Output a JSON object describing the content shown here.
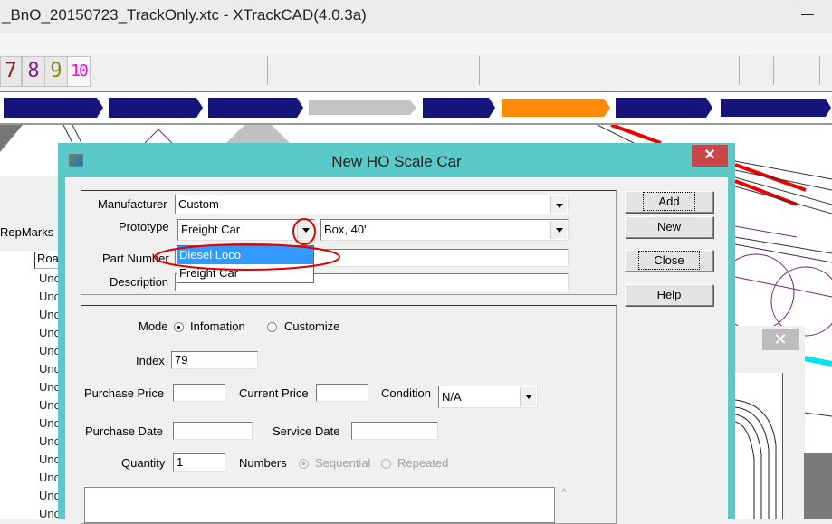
{
  "window": {
    "title": "_BnO_20150723_TrackOnly.xtc - XTrackCAD(4.0.3a)"
  },
  "toolbar": {
    "layer_buttons": [
      {
        "label": "7",
        "color": "#8b1a1a"
      },
      {
        "label": "8",
        "color": "#8b1a8b"
      },
      {
        "label": "9",
        "color": "#8b8b1a"
      },
      {
        "label": "10",
        "color": "#ff00ff"
      }
    ]
  },
  "map_strip": {
    "segments": [
      {
        "color": "#14147a"
      },
      {
        "color": "#14147a"
      },
      {
        "color": "#14147a"
      },
      {
        "color": "#c4c4c4"
      },
      {
        "color": "#14147a"
      },
      {
        "color": "#ff8a0a"
      },
      {
        "color": "#14147a"
      },
      {
        "color": "#14147a"
      }
    ]
  },
  "left_pane": {
    "header": "RepMarks",
    "column_header": "Roa",
    "rows": [
      "Unc",
      "Unc",
      "Unc",
      "Unc",
      "Unc",
      "Unc",
      "Unc",
      "Unc",
      "Unc",
      "Unc",
      "Unc",
      "Unc",
      "Unc",
      "Unc"
    ]
  },
  "background_dialog": {
    "close_label": "✕"
  },
  "dialog": {
    "title": "New HO Scale Car",
    "close_label": "✕",
    "manufacturer": {
      "label": "Manufacturer",
      "value": "Custom"
    },
    "prototype": {
      "label": "Prototype",
      "value": "Freight Car",
      "options": [
        "Diesel Loco",
        "Freight Car"
      ],
      "highlighted": "Diesel Loco"
    },
    "prototype_type": {
      "value": "Box, 40'"
    },
    "part_number": {
      "label": "Part Number",
      "value": ""
    },
    "description": {
      "label": "Description",
      "value": ""
    },
    "buttons": {
      "add": "Add",
      "new": "New",
      "close": "Close",
      "help": "Help"
    },
    "mode": {
      "label": "Mode",
      "options": [
        "Infomation",
        "Customize"
      ],
      "selected": "Infomation"
    },
    "index": {
      "label": "Index",
      "value": "79"
    },
    "purchase_price": {
      "label": "Purchase Price",
      "value": ""
    },
    "current_price": {
      "label": "Current Price",
      "value": ""
    },
    "condition": {
      "label": "Condition",
      "value": "N/A"
    },
    "purchase_date": {
      "label": "Purchase Date",
      "value": ""
    },
    "service_date": {
      "label": "Service Date",
      "value": ""
    },
    "quantity": {
      "label": "Quantity",
      "value": "1"
    },
    "numbers": {
      "label": "Numbers",
      "options": [
        "Sequential",
        "Repeated"
      ],
      "selected": "Sequential",
      "disabled": true
    },
    "notes": {
      "value": ""
    }
  },
  "annotations": {
    "color": "#e00000"
  }
}
